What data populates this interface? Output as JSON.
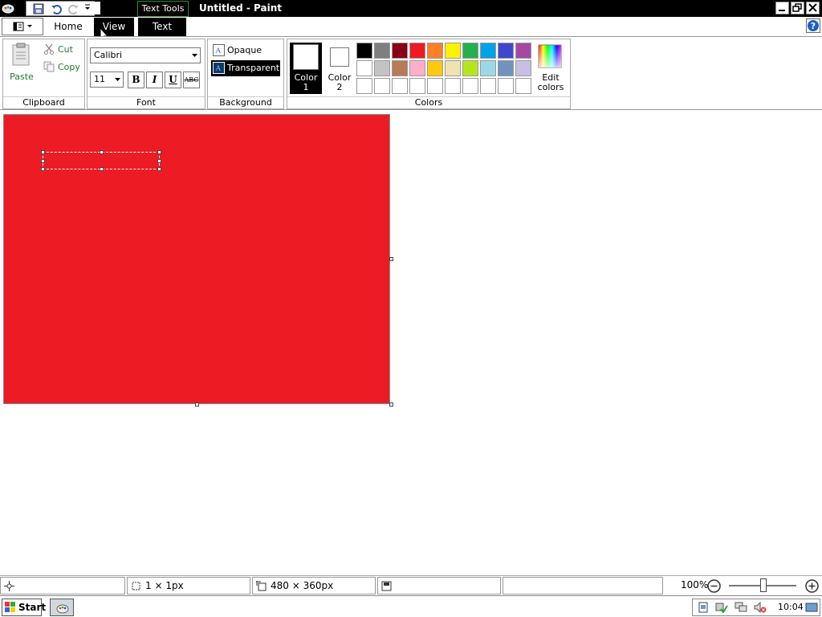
{
  "window": {
    "title": "Untitled - Paint",
    "context_tab": "Text Tools"
  },
  "tabs": {
    "home": "Home",
    "view": "View",
    "text": "Text"
  },
  "ribbon": {
    "clipboard": {
      "label": "Clipboard",
      "paste": "Paste",
      "cut": "Cut",
      "copy": "Copy"
    },
    "font": {
      "label": "Font",
      "family": "Calibri",
      "size": "11",
      "bold": "B",
      "italic": "I",
      "underline": "U",
      "strike": "ABC"
    },
    "background": {
      "label": "Background",
      "opaque": "Opaque",
      "transparent": "Transparent"
    },
    "colors": {
      "label": "Colors",
      "color1": "Color",
      "color1_num": "1",
      "color2": "Color",
      "color2_num": "2",
      "edit_line1": "Edit",
      "edit_line2": "colors",
      "palette_row1": [
        "#000000",
        "#7f7f7f",
        "#880015",
        "#ed1c24",
        "#ff7f27",
        "#fff200",
        "#22b14c",
        "#00a2e8",
        "#3f48cc",
        "#a349a4"
      ],
      "palette_row2": [
        "#ffffff",
        "#c3c3c3",
        "#b97a57",
        "#ffaec9",
        "#ffc90e",
        "#efe4b0",
        "#b5e61d",
        "#99d9ea",
        "#7092be",
        "#c8bfe7"
      ],
      "palette_row3": [
        "#ffffff",
        "#ffffff",
        "#ffffff",
        "#ffffff",
        "#ffffff",
        "#ffffff",
        "#ffffff",
        "#ffffff",
        "#ffffff",
        "#ffffff"
      ]
    }
  },
  "canvas": {
    "fill": "#ed1c24"
  },
  "status": {
    "selection": "1 × 1px",
    "size": "480 × 360px",
    "zoom": "100%"
  },
  "taskbar": {
    "start": "Start",
    "clock": "10:04"
  }
}
